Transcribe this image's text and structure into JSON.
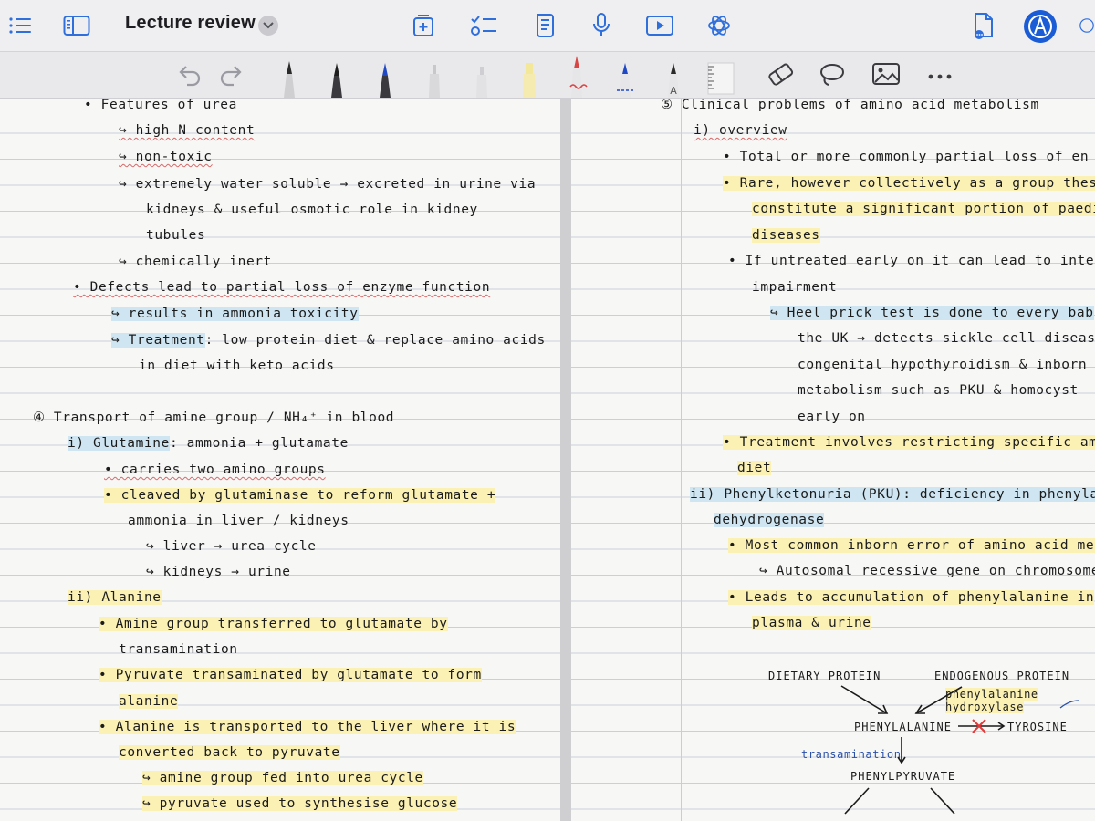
{
  "toolbar": {
    "title": "Lecture review",
    "icons": [
      "list-icon",
      "sidebar-icon",
      "chevron-down-icon",
      "add-page-icon",
      "checklist-icon",
      "document-icon",
      "microphone-icon",
      "play-icon",
      "ai-icon",
      "share-document-icon",
      "pencil-mode-icon",
      "more-circle-icon"
    ]
  },
  "tools": [
    "undo-icon",
    "redo-icon",
    "pen",
    "pen",
    "pen-blue",
    "pencil",
    "pencil",
    "highlighter-yellow",
    "pen-red",
    "pen-blue-dashed",
    "pen-text",
    "ruler-icon",
    "eraser-icon",
    "lasso-icon",
    "image-icon",
    "more-icon"
  ],
  "colors": {
    "yellow_highlight": "#fbf1b4",
    "blue_highlight": "#cfe6f2",
    "accent_blue": "#1a5bd6"
  },
  "left": {
    "lines": [
      {
        "t": "•  Features of urea"
      },
      {
        "t": "↪  high N content"
      },
      {
        "t": "↪  non-toxic"
      },
      {
        "t": "↪  extremely water soluble → excreted in urine via"
      },
      {
        "t": "kidneys &  useful osmotic role in kidney"
      },
      {
        "t": "tubules"
      },
      {
        "t": "↪  chemically inert"
      },
      {
        "t": "• Defects lead to partial loss of enzyme function"
      },
      {
        "t": "↪ results in ammonia toxicity"
      },
      {
        "t": "↪ Treatment"
      },
      {
        "t": ": low protein diet & replace amino acids"
      },
      {
        "t": "in diet with keto acids"
      },
      {
        "t": "④  Transport of amine group / NH₄⁺ in blood"
      },
      {
        "t": "i) Glutamine"
      },
      {
        "t": ":  ammonia + glutamate"
      },
      {
        "t": "• carries two amino groups"
      },
      {
        "t": "• cleaved by glutaminase to reform glutamate +"
      },
      {
        "t": "ammonia in liver / kidneys"
      },
      {
        "t": "↪ liver → urea cycle"
      },
      {
        "t": "↪ kidneys → urine"
      },
      {
        "t": "ii) Alanine"
      },
      {
        "t": "• Amine group transferred to glutamate by"
      },
      {
        "t": "transamination"
      },
      {
        "t": "• Pyruvate transaminated by glutamate to form"
      },
      {
        "t": "alanine"
      },
      {
        "t": "• Alanine is transported to the liver where it is"
      },
      {
        "t": "converted back to pyruvate"
      },
      {
        "t": "↪ amine group fed into urea cycle"
      },
      {
        "t": "↪ pyruvate used to synthesise glucose"
      }
    ]
  },
  "right": {
    "lines": [
      {
        "t": "⑤  Clinical problems of amino acid metabolism"
      },
      {
        "t": "i) overview"
      },
      {
        "t": "• Total or more commonly partial loss of en"
      },
      {
        "t": "• Rare, however collectively as a group these"
      },
      {
        "t": "constitute a significant portion of paediatri"
      },
      {
        "t": "diseases"
      },
      {
        "t": "• If untreated early on it can lead to inte"
      },
      {
        "t": "impairment"
      },
      {
        "t": "↪ Heel prick test is done to every bab"
      },
      {
        "t": "the UK → detects sickle cell disease"
      },
      {
        "t": "congenital hypothyroidism & inborn er"
      },
      {
        "t": "metabolism such as PKU & homocyst"
      },
      {
        "t": "early on"
      },
      {
        "t": "• Treatment involves restricting specific amino ac"
      },
      {
        "t": "diet"
      },
      {
        "t": "ii) Phenylketonuria (PKU): deficiency in phenylalanine"
      },
      {
        "t": "dehydrogenase"
      },
      {
        "t": "• Most common inborn error of amino acid metab"
      },
      {
        "t": "↪ Autosomal recessive gene on chromosome"
      },
      {
        "t": "• Leads to accumulation of phenylalanine in"
      },
      {
        "t": "plasma & urine"
      }
    ],
    "diagram": {
      "dietary": "DIETARY PROTEIN",
      "endogenous": "ENDOGENOUS PROTEIN",
      "enzyme1": "phenylalanine",
      "enzyme2": "hydroxylase",
      "phe": "PHENYLALANINE",
      "tyr": "TYROSINE",
      "trans": "transamination",
      "pyr": "PHENYLPYRUVATE"
    }
  }
}
